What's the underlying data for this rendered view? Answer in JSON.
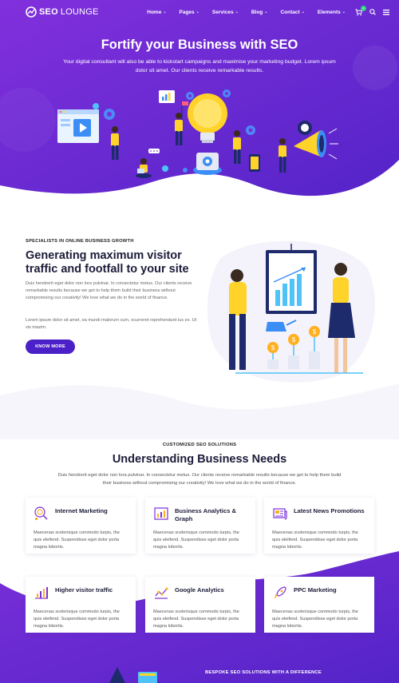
{
  "nav": {
    "logo_bold": "SEO",
    "logo_light": "LOUNGE",
    "items": [
      {
        "label": "Home"
      },
      {
        "label": "Pages"
      },
      {
        "label": "Services"
      },
      {
        "label": "Blog"
      },
      {
        "label": "Contact"
      },
      {
        "label": "Elements"
      }
    ],
    "cart_count": "0"
  },
  "hero": {
    "title": "Fortify your Business with SEO",
    "subtitle": "Your digital consultant will also be able to kickstart campaigns and maximise your marketing budget. Lorem ipsum dolor sit amet. Our clients receive remarkable results."
  },
  "growth": {
    "eyebrow": "SPECIALISTS IN ONLINE BUSINESS GROWTH",
    "title": "Generating maximum visitor traffic and footfall to your site",
    "paragraph1": "Duis hendrerit eget dolor non lora pulvinar. In consectetur metus. Our clients receive remarkable results because we get to help them build their business without compromising our creativity! We love what we do in the world of finance.",
    "paragraph2": "Lorem ipsum dolor sit amet, ea mundi malorum cum, ocurreret reprehendunt ius ex. Ut vis mazim.",
    "button": "KNOW MORE"
  },
  "solutions": {
    "eyebrow": "CUSTOMIZED SEO SOLUTIONS",
    "title": "Understanding Business Needs",
    "subtitle": "Duis hendrerit eget dolor non lora pulvinar. In consectetur metus. Our clients receive remarkable results because we get to help them build their business without compromising our creativity! We love what we do in the world of finance.",
    "cards": [
      {
        "title": "Internet Marketing",
        "icon": "marketing-icon",
        "text": "Maecenas scelerisque commodo turpis, the quis eleifend. Suspendisse eget dolor porta magna lobortis."
      },
      {
        "title": "Business Analytics & Graph",
        "icon": "analytics-graph-icon",
        "text": "Maecenas scelerisque commodo turpis, the quis eleifend. Suspendisse eget dolor porta magna lobortis."
      },
      {
        "title": "Latest News Promotions",
        "icon": "news-promotions-icon",
        "text": "Maecenas scelerisque commodo turpis, the quis eleifend. Suspendisse eget dolor porta magna lobortis."
      },
      {
        "title": "Higher visitor traffic",
        "icon": "traffic-chart-icon",
        "text": "Maecenas scelerisque commodo turpis, the quis eleifend. Suspendisse eget dolor porta magna lobortis."
      },
      {
        "title": "Google Analytics",
        "icon": "google-analytics-icon",
        "text": "Maecenas scelerisque commodo turpis, the quis eleifend. Suspendisse eget dolor porta magna lobortis."
      },
      {
        "title": "PPC Marketing",
        "icon": "rocket-icon",
        "text": "Maecenas scelerisque commodo turpis, the quis eleifend. Suspendisse eget dolor porta magna lobortis."
      }
    ]
  },
  "bespoke": {
    "eyebrow": "BESPOKE SEO SOLUTIONS WITH A DIFFERENCE"
  },
  "colors": {
    "primary": "#4c20c8",
    "hero_gradient_start": "#7a2fd8",
    "hero_gradient_end": "#5a25cc",
    "accent_yellow": "#ffd32a",
    "accent_cyan": "#4fc3f7"
  }
}
